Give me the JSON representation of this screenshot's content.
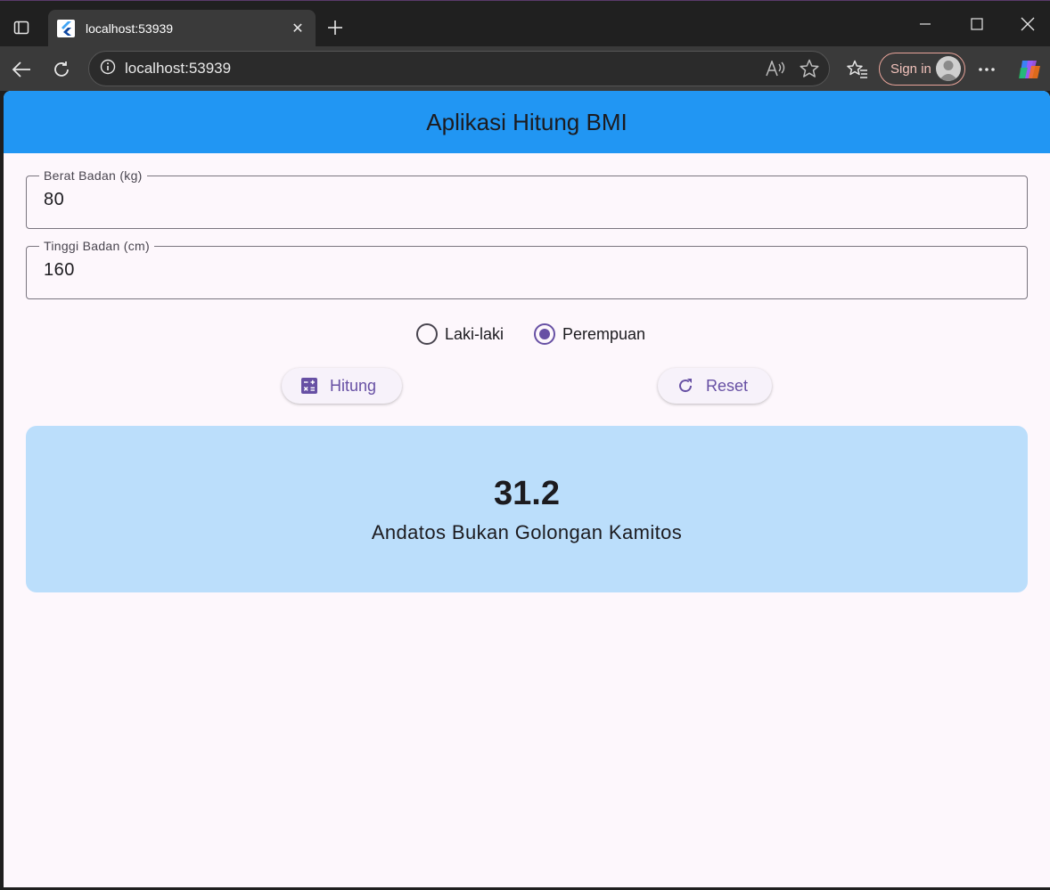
{
  "browser": {
    "tab_title": "localhost:53939",
    "url": "localhost:53939",
    "sign_in_label": "Sign in"
  },
  "app": {
    "title": "Aplikasi Hitung BMI",
    "weight_field": {
      "label": "Berat Badan (kg)",
      "value": "80"
    },
    "height_field": {
      "label": "Tinggi Badan (cm)",
      "value": "160"
    },
    "gender": {
      "options": [
        "Laki-laki",
        "Perempuan"
      ],
      "selected": "Perempuan"
    },
    "buttons": {
      "calculate": "Hitung",
      "reset": "Reset"
    },
    "result": {
      "bmi": "31.2",
      "category": "Andatos Bukan Golongan Kamitos"
    }
  },
  "colors": {
    "appbar": "#2196f3",
    "result_bg": "#bbdefb",
    "accent": "#6750a4",
    "page_bg": "#fdf7fc"
  }
}
